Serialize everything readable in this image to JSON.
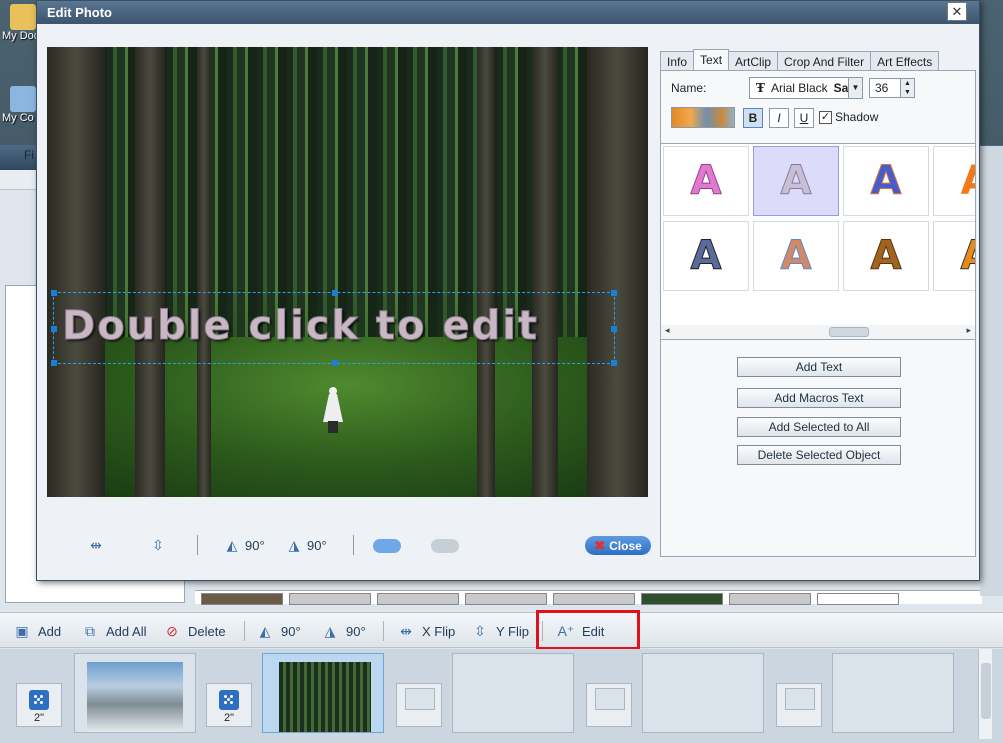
{
  "dialog": {
    "title": "Edit Photo",
    "close_glyph": "✕"
  },
  "desktop": {
    "icon1": "My Doc",
    "icon2": "My Co",
    "menu_letter": "Fi"
  },
  "canvas": {
    "overlay_text": "Double click to edit"
  },
  "canvas_tools": {
    "rotate_left_label": "90°",
    "rotate_right_label": "90°",
    "close_label": "Close"
  },
  "panel": {
    "tabs": [
      "Info",
      "Text",
      "ArtClip",
      "Crop And Filter",
      "Art Effects"
    ],
    "active_tab": "Text",
    "name_label": "Name:",
    "font_name": "Arial Black",
    "font_sample": "Sa",
    "font_size": "36",
    "bold": "B",
    "italic": "I",
    "underline": "U",
    "shadow_label": "Shadow",
    "shadow_checked": true,
    "buttons": {
      "add_text": "Add Text",
      "add_macros": "Add Macros Text",
      "add_selected": "Add Selected to All",
      "delete_selected": "Delete Selected Object"
    }
  },
  "toolbar": {
    "add": "Add",
    "add_all": "Add All",
    "delete": "Delete",
    "rotate_left": "90°",
    "rotate_right": "90°",
    "x_flip": "X Flip",
    "y_flip": "Y Flip",
    "edit": "Edit"
  },
  "timeline": {
    "transition_duration": "2\""
  },
  "colors": {
    "highlight": "#e0111a",
    "accent": "#2f6fc3"
  }
}
